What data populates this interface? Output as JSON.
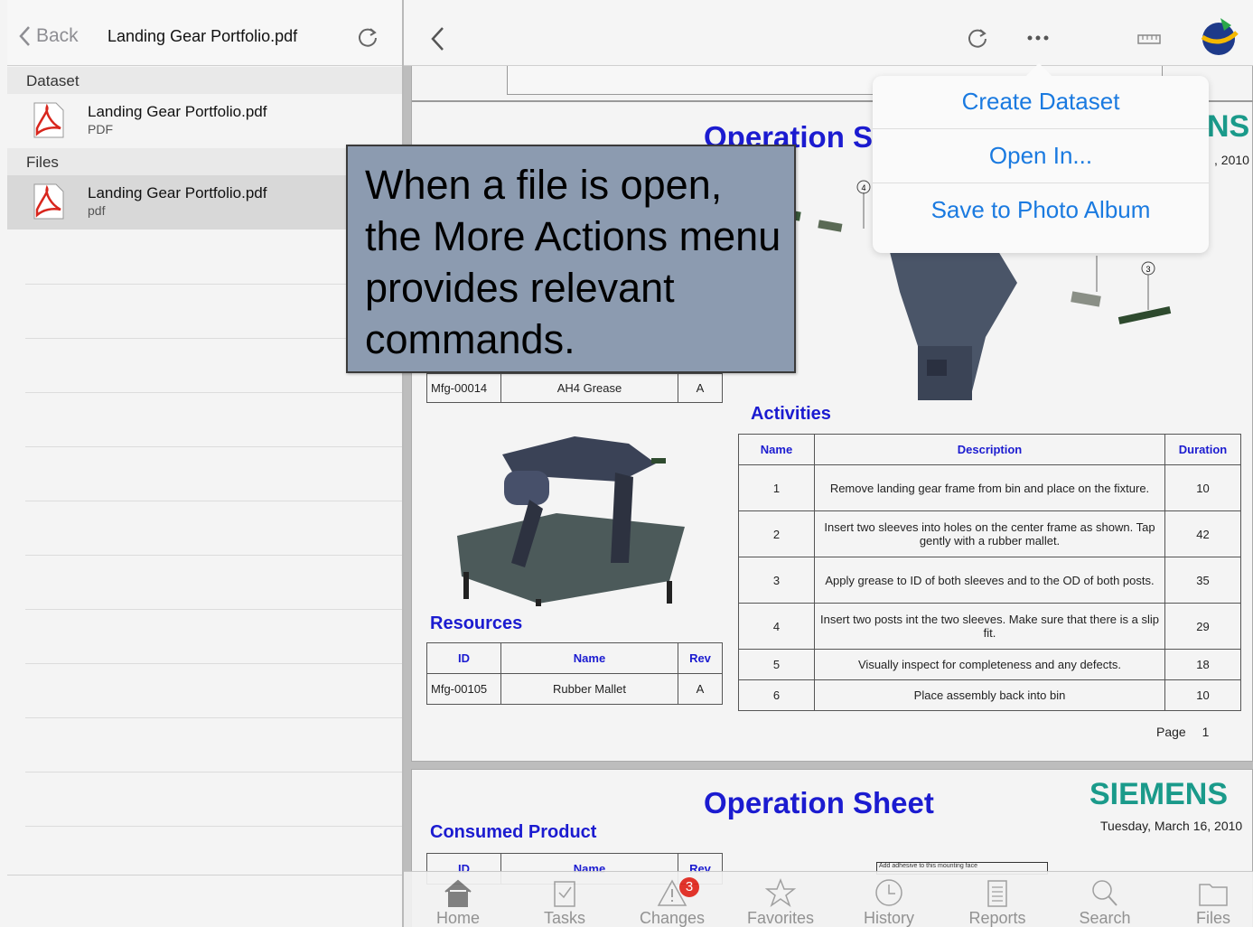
{
  "left_panel": {
    "back_label": "Back",
    "title": "Landing Gear Portfolio.pdf",
    "dataset_header": "Dataset",
    "dataset_item": {
      "name": "Landing Gear Portfolio.pdf",
      "type": "PDF"
    },
    "files_header": "Files",
    "files_item": {
      "name": "Landing Gear Portfolio.pdf",
      "type": "pdf"
    }
  },
  "document": {
    "page1": {
      "title_partial": "Operation S",
      "brand_partial": "NS",
      "date_partial": ", 2010",
      "callout_numbers": [
        "4",
        "3"
      ],
      "resource_row_above": {
        "id": "Mfg-00014",
        "name": "AH4 Grease",
        "rev": "A"
      },
      "activities_title": "Activities",
      "activities_headers": [
        "Name",
        "Description",
        "Duration"
      ],
      "activities": [
        {
          "name": "1",
          "description": "Remove landing gear frame from bin and place on the fixture.",
          "duration": "10"
        },
        {
          "name": "2",
          "description": "Insert two sleeves into holes on the center frame as shown. Tap gently with a rubber mallet.",
          "duration": "42"
        },
        {
          "name": "3",
          "description": "Apply grease to ID of both sleeves and to the OD of both posts.",
          "duration": "35"
        },
        {
          "name": "4",
          "description": "Insert two posts int the two sleeves.  Make sure that there is a slip fit.",
          "duration": "29"
        },
        {
          "name": "5",
          "description": "Visually inspect for completeness and any defects.",
          "duration": "18"
        },
        {
          "name": "6",
          "description": "Place assembly back into bin",
          "duration": "10"
        }
      ],
      "resources_title": "Resources",
      "resources_headers": [
        "ID",
        "Name",
        "Rev"
      ],
      "resources": [
        {
          "id": "Mfg-00105",
          "name": "Rubber Mallet",
          "rev": "A"
        }
      ],
      "page_label": "Page",
      "page_number": "1"
    },
    "page2": {
      "title": "Operation Sheet",
      "brand": "SIEMENS",
      "date": "Tuesday, March 16, 2010",
      "consumed_title": "Consumed Product",
      "headers": [
        "ID",
        "Name",
        "Rev"
      ],
      "small_box": "Add adhesive to this mounting face"
    }
  },
  "more_actions_menu": {
    "items": [
      "Create Dataset",
      "Open In...",
      "Save to Photo Album"
    ]
  },
  "callout_text": "When a file is open, the More Actions menu provides relevant commands.",
  "tabbar": {
    "tabs": [
      "Home",
      "Tasks",
      "Changes",
      "Favorites",
      "History",
      "Reports",
      "Search",
      "Files"
    ],
    "changes_badge": "3"
  },
  "colors": {
    "accent": "#1a7ae0",
    "doc_heading": "#1b1bd0",
    "brand": "#1a9a8a",
    "badge": "#e0241b"
  }
}
